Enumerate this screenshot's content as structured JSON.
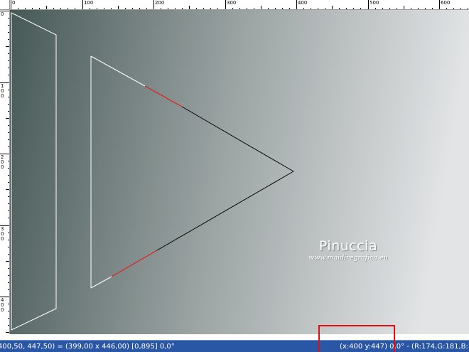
{
  "rulers": {
    "top_labels": [
      "0",
      "100",
      "200",
      "300",
      "400",
      "500",
      "600"
    ],
    "left_labels": [
      "0",
      "100",
      "200",
      "300",
      "400"
    ]
  },
  "canvas": {
    "gradient_start": "#465957",
    "gradient_end": "#e2e4e6",
    "shapes_stroke": "#ffffff",
    "selection_stroke": "#e02020",
    "outline_dark": "#000000"
  },
  "watermark": {
    "name": "Pinuccia",
    "url": "www.maidiregrafica.eu"
  },
  "status_bar": {
    "selection_info": "400,50, 447,50) = (399,00 x 446,00) [0,895]  0,0°",
    "cursor_info": "(x:400 y:447) 0,0° - (R:174,G:181,B:"
  },
  "colors": {
    "status_bar_bg": "#2a56a6",
    "highlight": "#e01010"
  }
}
